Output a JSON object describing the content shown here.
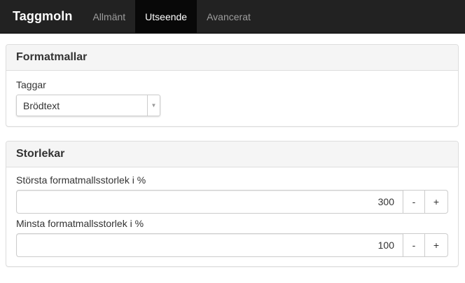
{
  "navbar": {
    "brand": "Taggmoln",
    "tabs": [
      {
        "label": "Allmänt",
        "active": false
      },
      {
        "label": "Utseende",
        "active": true
      },
      {
        "label": "Avancerat",
        "active": false
      }
    ]
  },
  "formats_panel": {
    "title": "Formatmallar",
    "tags_label": "Taggar",
    "tags_selected": "Brödtext"
  },
  "sizes_panel": {
    "title": "Storlekar",
    "max_label": "Största formatmallsstorlek i %",
    "max_value": "300",
    "min_label": "Minsta formatmallsstorlek i %",
    "min_value": "100",
    "decrement": "-",
    "increment": "+"
  },
  "colors": {
    "navbar_bg": "#222222",
    "active_tab_bg": "#080808",
    "panel_heading_bg": "#f5f5f5"
  }
}
